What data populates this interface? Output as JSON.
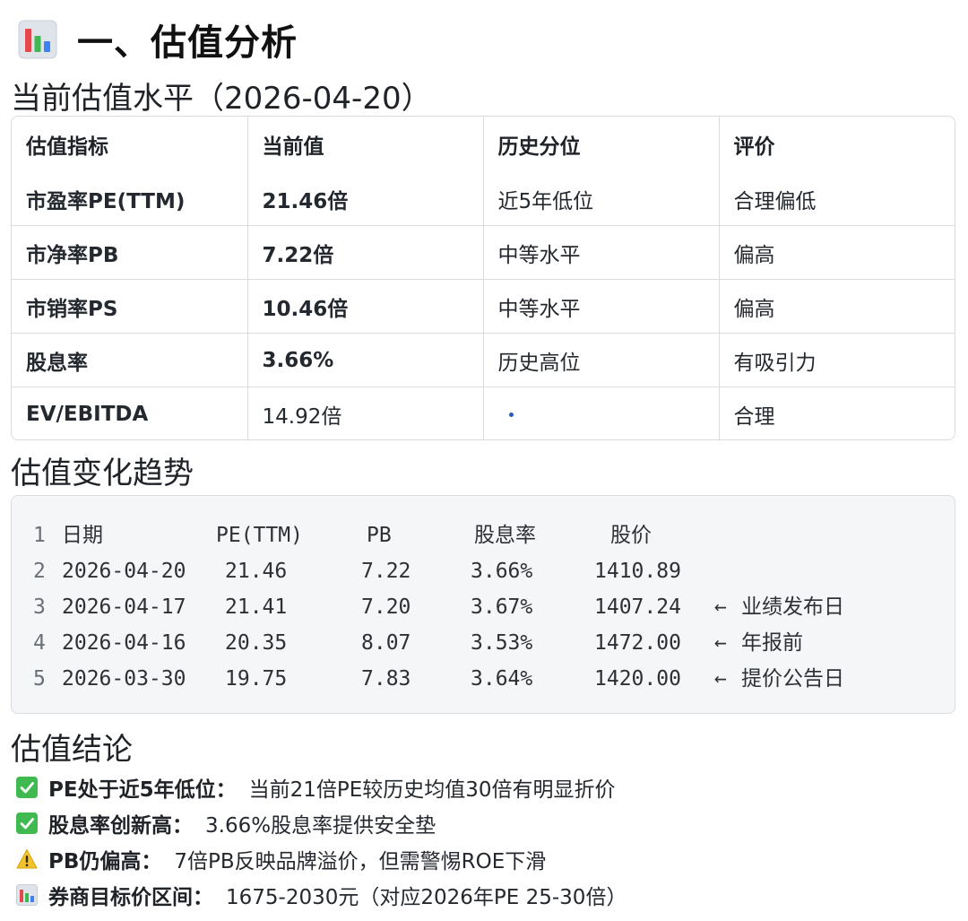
{
  "header": {
    "icon": "bar-chart-icon",
    "title": "一、估值分析"
  },
  "current": {
    "heading": "当前估值水平（2026-04-20）",
    "columns": [
      "估值指标",
      "当前值",
      "历史分位",
      "评价"
    ],
    "rows": [
      {
        "metric": "市盈率PE(TTM)",
        "value": "21.46倍",
        "percentile": "近5年低位",
        "rating": "合理偏低"
      },
      {
        "metric": "市净率PB",
        "value": "7.22倍",
        "percentile": "中等水平",
        "rating": "偏高"
      },
      {
        "metric": "市销率PS",
        "value": "10.46倍",
        "percentile": "中等水平",
        "rating": "偏高"
      },
      {
        "metric": "股息率",
        "value": "3.66%",
        "percentile": "历史高位",
        "rating": "有吸引力"
      },
      {
        "metric": "EV/EBITDA",
        "value": "14.92倍",
        "percentile": "",
        "rating": "合理"
      }
    ]
  },
  "trend": {
    "heading": "估值变化趋势",
    "header": {
      "ln": "1",
      "date": "日期",
      "pe": "PE(TTM)",
      "pb": "PB",
      "dy": "股息率",
      "price": "股价"
    },
    "rows": [
      {
        "ln": "2",
        "date": "2026-04-20",
        "pe": "21.46",
        "pb": "7.22",
        "dy": "3.66%",
        "price": "1410.89",
        "arrow": "",
        "note": ""
      },
      {
        "ln": "3",
        "date": "2026-04-17",
        "pe": "21.41",
        "pb": "7.20",
        "dy": "3.67%",
        "price": "1407.24",
        "arrow": "←",
        "note": "业绩发布日"
      },
      {
        "ln": "4",
        "date": "2026-04-16",
        "pe": "20.35",
        "pb": "8.07",
        "dy": "3.53%",
        "price": "1472.00",
        "arrow": "←",
        "note": "年报前"
      },
      {
        "ln": "5",
        "date": "2026-03-30",
        "pe": "19.75",
        "pb": "7.83",
        "dy": "3.64%",
        "price": "1420.00",
        "arrow": "←",
        "note": "提价公告日"
      }
    ]
  },
  "conclusion": {
    "heading": "估值结论",
    "items": [
      {
        "icon": "check-box-icon",
        "title": "PE处于近5年低位：",
        "text": "当前21倍PE较历史均值30倍有明显折价"
      },
      {
        "icon": "check-box-icon",
        "title": "股息率创新高：",
        "text": "3.66%股息率提供安全垫"
      },
      {
        "icon": "warning-icon",
        "title": "PB仍偏高：",
        "text": "7倍PB反映品牌溢价，但需警惕ROE下滑"
      },
      {
        "icon": "bar-chart-icon",
        "title": "券商目标价区间：",
        "text": "1675-2030元（对应2026年PE 25-30倍）"
      }
    ]
  },
  "colors": {
    "check_green": "#3fb950",
    "warning_yellow": "#f2c230",
    "table_border": "#d8dce0",
    "code_bg": "#f4f6f8"
  }
}
